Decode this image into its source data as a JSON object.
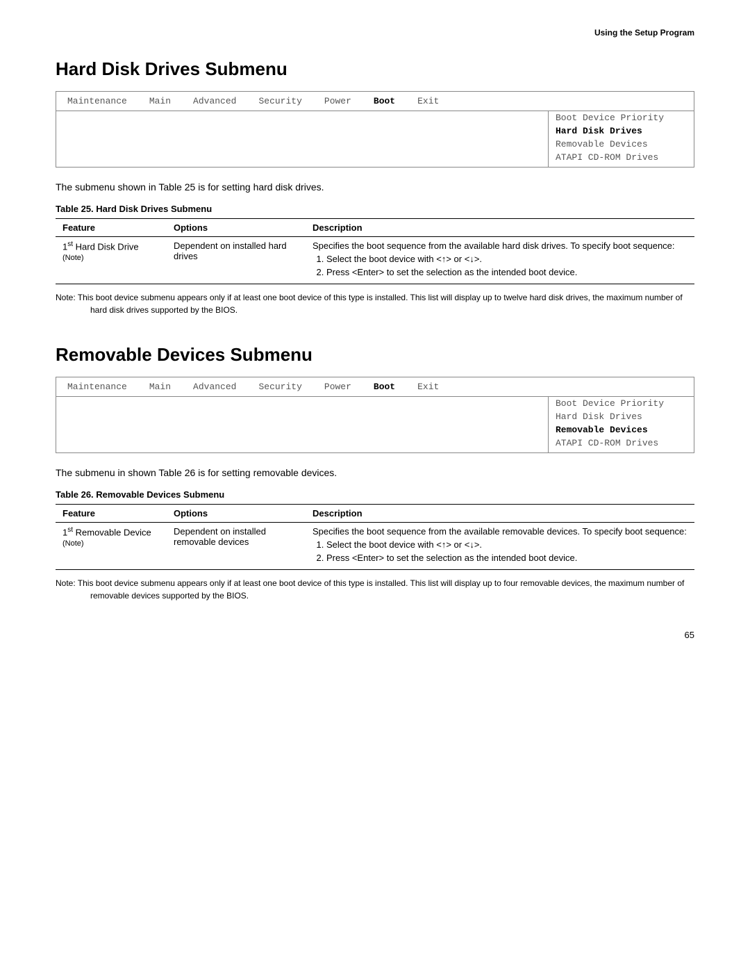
{
  "page_header": "Using the Setup Program",
  "section1": {
    "title": "Hard Disk Drives Submenu",
    "bios_menu": {
      "items": [
        {
          "label": "Maintenance",
          "active": false
        },
        {
          "label": "Main",
          "active": false
        },
        {
          "label": "Advanced",
          "active": false
        },
        {
          "label": "Security",
          "active": false
        },
        {
          "label": "Power",
          "active": false
        },
        {
          "label": "Boot",
          "active": true
        },
        {
          "label": "Exit",
          "active": false
        }
      ],
      "submenu_items": [
        {
          "label": "Boot Device Priority",
          "highlighted": false
        },
        {
          "label": "Hard Disk Drives",
          "highlighted": true
        },
        {
          "label": "Removable Devices",
          "highlighted": false
        },
        {
          "label": "ATAPI CD-ROM Drives",
          "highlighted": false
        }
      ]
    },
    "intro": "The submenu shown in Table 25 is for setting hard disk drives.",
    "table_title": "Table 25.  Hard Disk Drives Submenu",
    "table": {
      "headers": [
        "Feature",
        "Options",
        "Description"
      ],
      "rows": [
        {
          "feature": "1st Hard Disk Drive",
          "feature_note": "(Note)",
          "options": "Dependent on installed hard drives",
          "description_text": "Specifies the boot sequence from the available hard disk drives.  To specify boot sequence:",
          "description_list": [
            "Select the boot device with <↑> or <↓>.",
            "Press <Enter> to set the selection as the intended boot device."
          ]
        }
      ]
    },
    "note": "Note: This boot device submenu appears only if at least one boot device of this type is installed.  This list will display up to twelve hard disk drives, the maximum number of hard disk drives supported by the BIOS."
  },
  "section2": {
    "title": "Removable Devices Submenu",
    "bios_menu": {
      "items": [
        {
          "label": "Maintenance",
          "active": false
        },
        {
          "label": "Main",
          "active": false
        },
        {
          "label": "Advanced",
          "active": false
        },
        {
          "label": "Security",
          "active": false
        },
        {
          "label": "Power",
          "active": false
        },
        {
          "label": "Boot",
          "active": true
        },
        {
          "label": "Exit",
          "active": false
        }
      ],
      "submenu_items": [
        {
          "label": "Boot Device Priority",
          "highlighted": false
        },
        {
          "label": "Hard Disk Drives",
          "highlighted": false
        },
        {
          "label": "Removable Devices",
          "highlighted": true
        },
        {
          "label": "ATAPI CD-ROM Drives",
          "highlighted": false
        }
      ]
    },
    "intro": "The submenu in shown Table 26 is for setting removable devices.",
    "table_title": "Table 26.  Removable Devices Submenu",
    "table": {
      "headers": [
        "Feature",
        "Options",
        "Description"
      ],
      "rows": [
        {
          "feature": "1st Removable Device",
          "feature_note": "(Note)",
          "options": "Dependent on installed removable devices",
          "description_text": "Specifies the boot sequence from the available removable devices.  To specify boot sequence:",
          "description_list": [
            "Select the boot device with <↑> or <↓>.",
            "Press <Enter> to set the selection as the intended boot device."
          ]
        }
      ]
    },
    "note": "Note: This boot device submenu appears only if at least one boot device of this type is installed.  This list will display up to four removable devices, the maximum number of removable devices supported by the BIOS."
  },
  "page_number": "65"
}
